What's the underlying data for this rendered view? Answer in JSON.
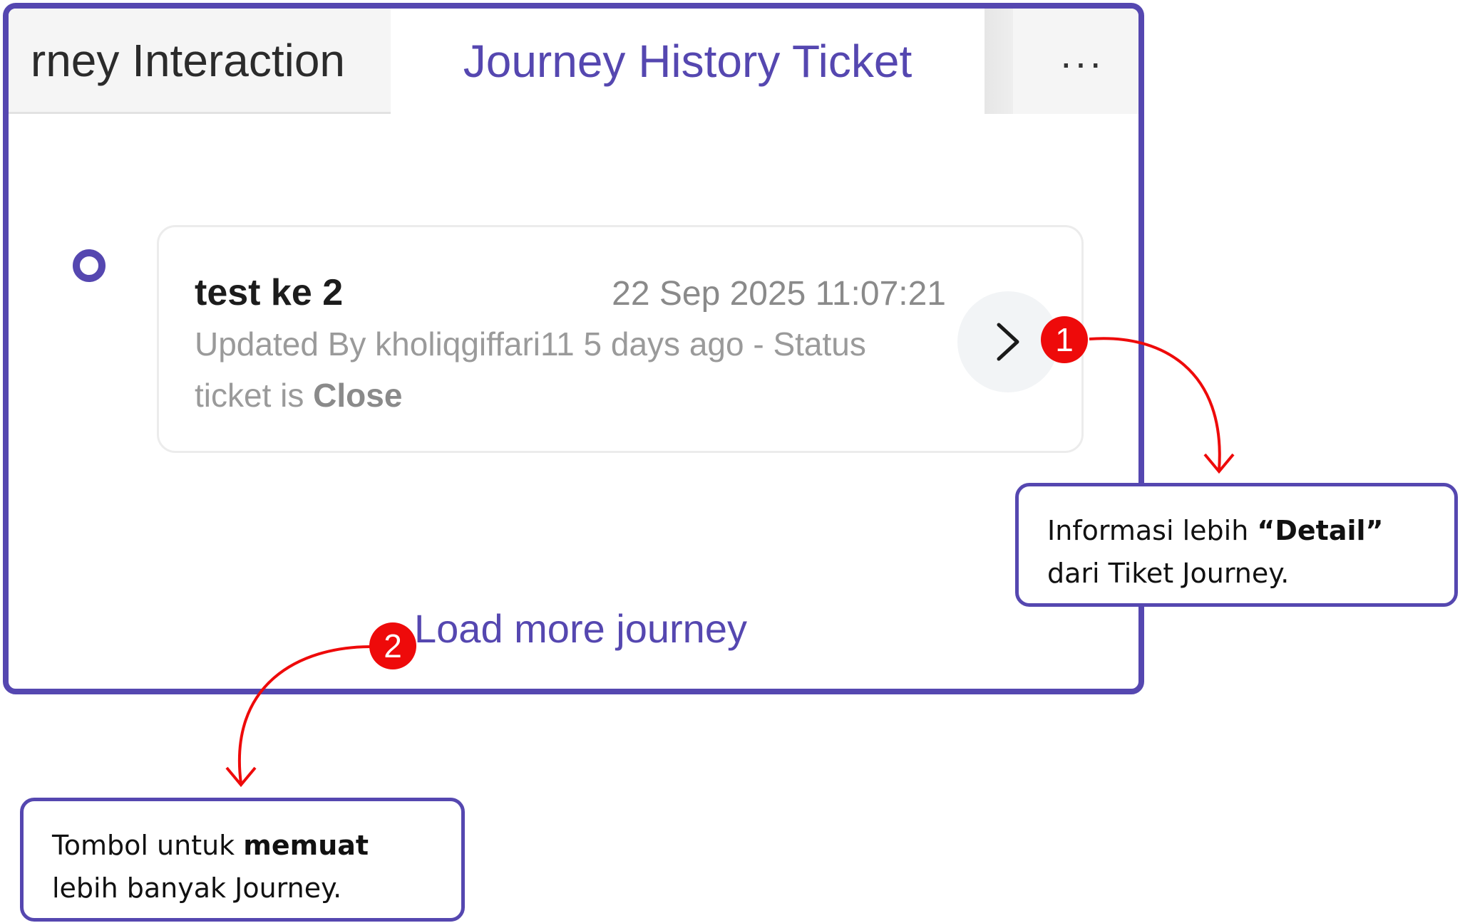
{
  "tabs": {
    "inactive_label": "rney Interaction",
    "active_label": "Journey History Ticket",
    "more_label": "···"
  },
  "journey_item": {
    "title": "test ke 2",
    "datetime": "22 Sep 2025 11:07:21",
    "updated_text": "Updated By kholiqgiffari11 5 days ago - Status",
    "status_prefix": "ticket is ",
    "status_value": "Close"
  },
  "load_more_label": "Load more journey",
  "annotations": [
    {
      "number": "1",
      "line1_prefix": "Informasi lebih ",
      "line1_bold": "“Detail”",
      "line2": "dari Tiket Journey."
    },
    {
      "number": "2",
      "line1_prefix": "Tombol untuk ",
      "line1_bold": "memuat",
      "line2": "lebih banyak Journey."
    }
  ],
  "colors": {
    "accent": "#5547b0",
    "annotation_red": "#ee0a0a",
    "muted_text": "#9a9a9a"
  },
  "icons": [
    "more-icon",
    "chevron-right-icon"
  ]
}
